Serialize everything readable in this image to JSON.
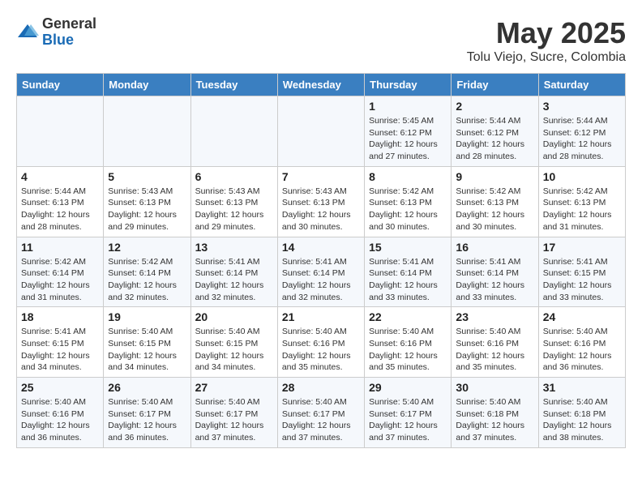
{
  "header": {
    "logo_general": "General",
    "logo_blue": "Blue",
    "title": "May 2025",
    "subtitle": "Tolu Viejo, Sucre, Colombia"
  },
  "days_of_week": [
    "Sunday",
    "Monday",
    "Tuesday",
    "Wednesday",
    "Thursday",
    "Friday",
    "Saturday"
  ],
  "weeks": [
    [
      {
        "day": "",
        "info": ""
      },
      {
        "day": "",
        "info": ""
      },
      {
        "day": "",
        "info": ""
      },
      {
        "day": "",
        "info": ""
      },
      {
        "day": "1",
        "info": "Sunrise: 5:45 AM\nSunset: 6:12 PM\nDaylight: 12 hours\nand 27 minutes."
      },
      {
        "day": "2",
        "info": "Sunrise: 5:44 AM\nSunset: 6:12 PM\nDaylight: 12 hours\nand 28 minutes."
      },
      {
        "day": "3",
        "info": "Sunrise: 5:44 AM\nSunset: 6:12 PM\nDaylight: 12 hours\nand 28 minutes."
      }
    ],
    [
      {
        "day": "4",
        "info": "Sunrise: 5:44 AM\nSunset: 6:13 PM\nDaylight: 12 hours\nand 28 minutes."
      },
      {
        "day": "5",
        "info": "Sunrise: 5:43 AM\nSunset: 6:13 PM\nDaylight: 12 hours\nand 29 minutes."
      },
      {
        "day": "6",
        "info": "Sunrise: 5:43 AM\nSunset: 6:13 PM\nDaylight: 12 hours\nand 29 minutes."
      },
      {
        "day": "7",
        "info": "Sunrise: 5:43 AM\nSunset: 6:13 PM\nDaylight: 12 hours\nand 30 minutes."
      },
      {
        "day": "8",
        "info": "Sunrise: 5:42 AM\nSunset: 6:13 PM\nDaylight: 12 hours\nand 30 minutes."
      },
      {
        "day": "9",
        "info": "Sunrise: 5:42 AM\nSunset: 6:13 PM\nDaylight: 12 hours\nand 30 minutes."
      },
      {
        "day": "10",
        "info": "Sunrise: 5:42 AM\nSunset: 6:13 PM\nDaylight: 12 hours\nand 31 minutes."
      }
    ],
    [
      {
        "day": "11",
        "info": "Sunrise: 5:42 AM\nSunset: 6:14 PM\nDaylight: 12 hours\nand 31 minutes."
      },
      {
        "day": "12",
        "info": "Sunrise: 5:42 AM\nSunset: 6:14 PM\nDaylight: 12 hours\nand 32 minutes."
      },
      {
        "day": "13",
        "info": "Sunrise: 5:41 AM\nSunset: 6:14 PM\nDaylight: 12 hours\nand 32 minutes."
      },
      {
        "day": "14",
        "info": "Sunrise: 5:41 AM\nSunset: 6:14 PM\nDaylight: 12 hours\nand 32 minutes."
      },
      {
        "day": "15",
        "info": "Sunrise: 5:41 AM\nSunset: 6:14 PM\nDaylight: 12 hours\nand 33 minutes."
      },
      {
        "day": "16",
        "info": "Sunrise: 5:41 AM\nSunset: 6:14 PM\nDaylight: 12 hours\nand 33 minutes."
      },
      {
        "day": "17",
        "info": "Sunrise: 5:41 AM\nSunset: 6:15 PM\nDaylight: 12 hours\nand 33 minutes."
      }
    ],
    [
      {
        "day": "18",
        "info": "Sunrise: 5:41 AM\nSunset: 6:15 PM\nDaylight: 12 hours\nand 34 minutes."
      },
      {
        "day": "19",
        "info": "Sunrise: 5:40 AM\nSunset: 6:15 PM\nDaylight: 12 hours\nand 34 minutes."
      },
      {
        "day": "20",
        "info": "Sunrise: 5:40 AM\nSunset: 6:15 PM\nDaylight: 12 hours\nand 34 minutes."
      },
      {
        "day": "21",
        "info": "Sunrise: 5:40 AM\nSunset: 6:16 PM\nDaylight: 12 hours\nand 35 minutes."
      },
      {
        "day": "22",
        "info": "Sunrise: 5:40 AM\nSunset: 6:16 PM\nDaylight: 12 hours\nand 35 minutes."
      },
      {
        "day": "23",
        "info": "Sunrise: 5:40 AM\nSunset: 6:16 PM\nDaylight: 12 hours\nand 35 minutes."
      },
      {
        "day": "24",
        "info": "Sunrise: 5:40 AM\nSunset: 6:16 PM\nDaylight: 12 hours\nand 36 minutes."
      }
    ],
    [
      {
        "day": "25",
        "info": "Sunrise: 5:40 AM\nSunset: 6:16 PM\nDaylight: 12 hours\nand 36 minutes."
      },
      {
        "day": "26",
        "info": "Sunrise: 5:40 AM\nSunset: 6:17 PM\nDaylight: 12 hours\nand 36 minutes."
      },
      {
        "day": "27",
        "info": "Sunrise: 5:40 AM\nSunset: 6:17 PM\nDaylight: 12 hours\nand 37 minutes."
      },
      {
        "day": "28",
        "info": "Sunrise: 5:40 AM\nSunset: 6:17 PM\nDaylight: 12 hours\nand 37 minutes."
      },
      {
        "day": "29",
        "info": "Sunrise: 5:40 AM\nSunset: 6:17 PM\nDaylight: 12 hours\nand 37 minutes."
      },
      {
        "day": "30",
        "info": "Sunrise: 5:40 AM\nSunset: 6:18 PM\nDaylight: 12 hours\nand 37 minutes."
      },
      {
        "day": "31",
        "info": "Sunrise: 5:40 AM\nSunset: 6:18 PM\nDaylight: 12 hours\nand 38 minutes."
      }
    ]
  ]
}
